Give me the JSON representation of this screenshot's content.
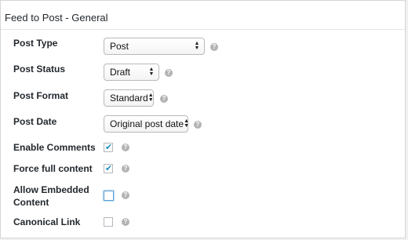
{
  "panel": {
    "title": "Feed to Post - General"
  },
  "help_glyph": "?",
  "fields": {
    "post_type": {
      "label": "Post Type",
      "value": "Post"
    },
    "post_status": {
      "label": "Post Status",
      "value": "Draft"
    },
    "post_format": {
      "label": "Post Format",
      "value": "Standard"
    },
    "post_date": {
      "label": "Post Date",
      "value": "Original post date"
    },
    "enable_comments": {
      "label": "Enable Comments",
      "checked": true
    },
    "force_full_content": {
      "label": "Force full content",
      "checked": true
    },
    "allow_embedded": {
      "label_line1": "Allow Embedded",
      "label_line2": "Content",
      "checked": false
    },
    "canonical_link": {
      "label": "Canonical Link",
      "checked": false
    }
  },
  "colors": {
    "accent": "#1e8cbe",
    "focus_border": "#5b9dd9",
    "help_icon": "#b3b3b3"
  }
}
